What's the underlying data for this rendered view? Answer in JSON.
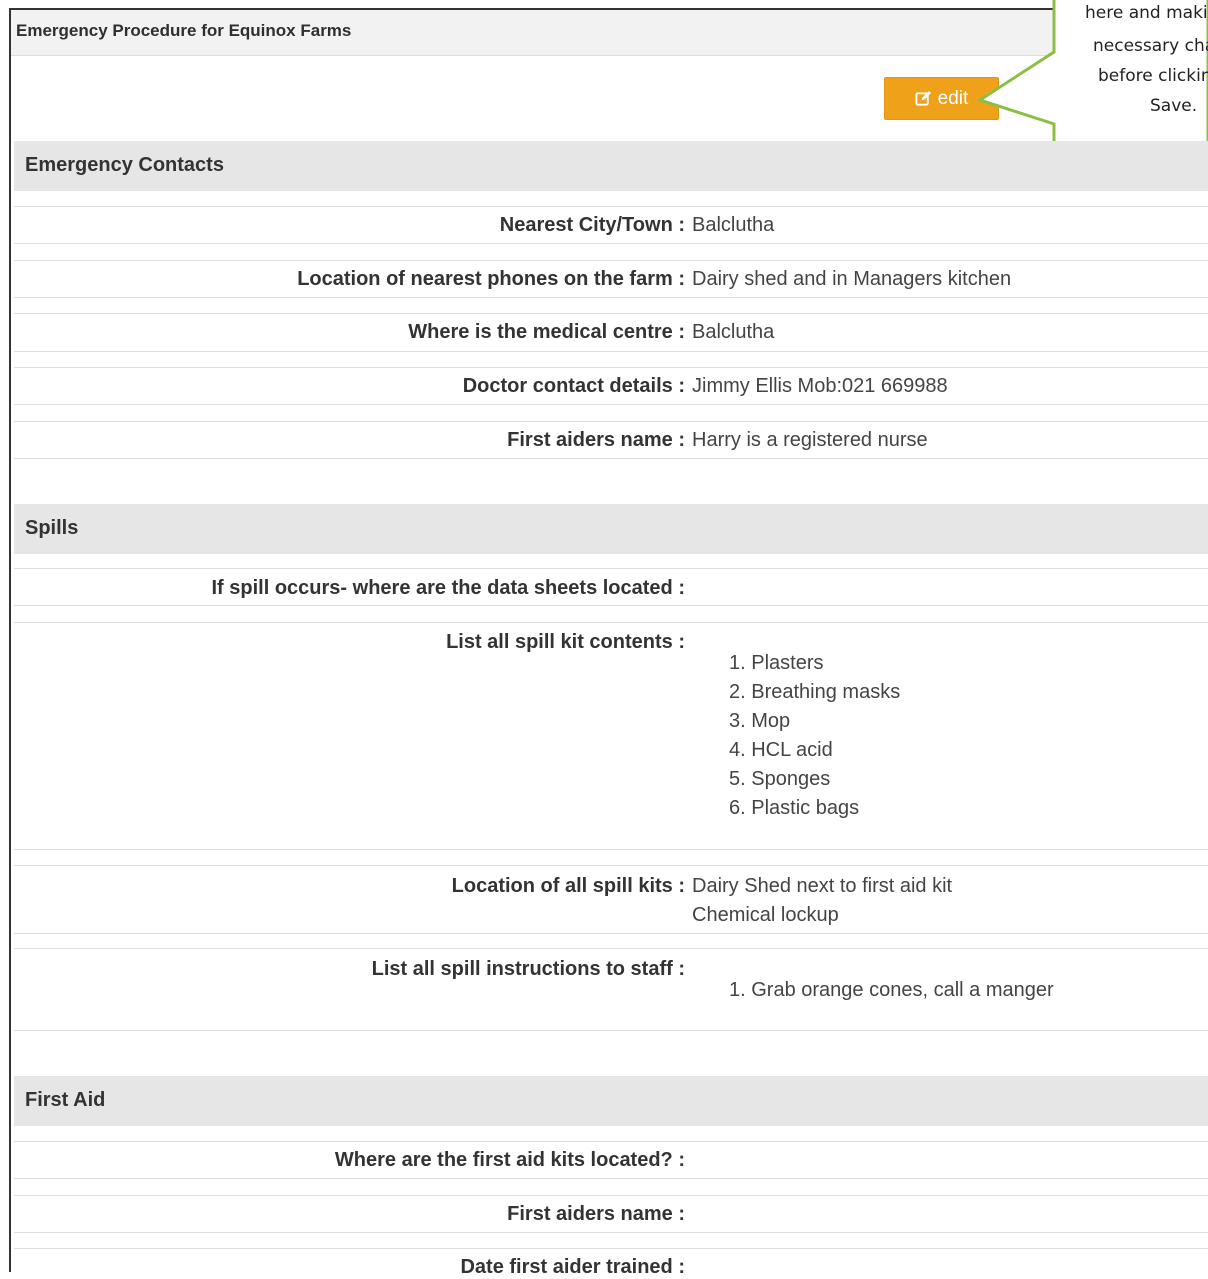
{
  "panel": {
    "title": "Emergency Procedure for Equinox Farms"
  },
  "toolbar": {
    "edit_label": "edit"
  },
  "callout": {
    "lines": [
      "here and maki",
      "necessary cha",
      "before clickin",
      "Save."
    ]
  },
  "sections": {
    "emergency_contacts": {
      "title": "Emergency Contacts",
      "rows": [
        {
          "label": "Nearest City/Town :",
          "value": "Balclutha"
        },
        {
          "label": "Location of nearest phones on the farm :",
          "value": "Dairy shed and in Managers kitchen"
        },
        {
          "label": "Where is the medical centre :",
          "value": "Balclutha"
        },
        {
          "label": "Doctor contact details :",
          "value": "Jimmy Ellis Mob:021 669988"
        },
        {
          "label": "First aiders name :",
          "value": "Harry is a registered nurse"
        }
      ]
    },
    "spills": {
      "title": "Spills",
      "data_sheets_label": "If spill occurs- where are the data sheets located :",
      "kit_contents_label": "List all spill kit contents :",
      "kit_contents": [
        "1. Plasters",
        "2. Breathing masks",
        "3. Mop",
        "4. HCL acid",
        "5. Sponges",
        "6. Plastic bags"
      ],
      "kit_locations_label": "Location of all spill kits :",
      "kit_locations": [
        "Dairy Shed next to first aid kit",
        "Chemical lockup"
      ],
      "instructions_label": "List all spill instructions to staff :",
      "instructions": [
        "1. Grab orange cones, call a manger"
      ]
    },
    "first_aid": {
      "title": "First Aid",
      "rows": [
        {
          "label": "Where are the first aid kits located? :",
          "value": ""
        },
        {
          "label": "First aiders name :",
          "value": ""
        },
        {
          "label": "Date first aider trained :",
          "value": ""
        }
      ]
    }
  },
  "colors": {
    "edit_button": "#f0a11a",
    "callout_border": "#8cbe45",
    "section_header": "#e6e6e6"
  }
}
